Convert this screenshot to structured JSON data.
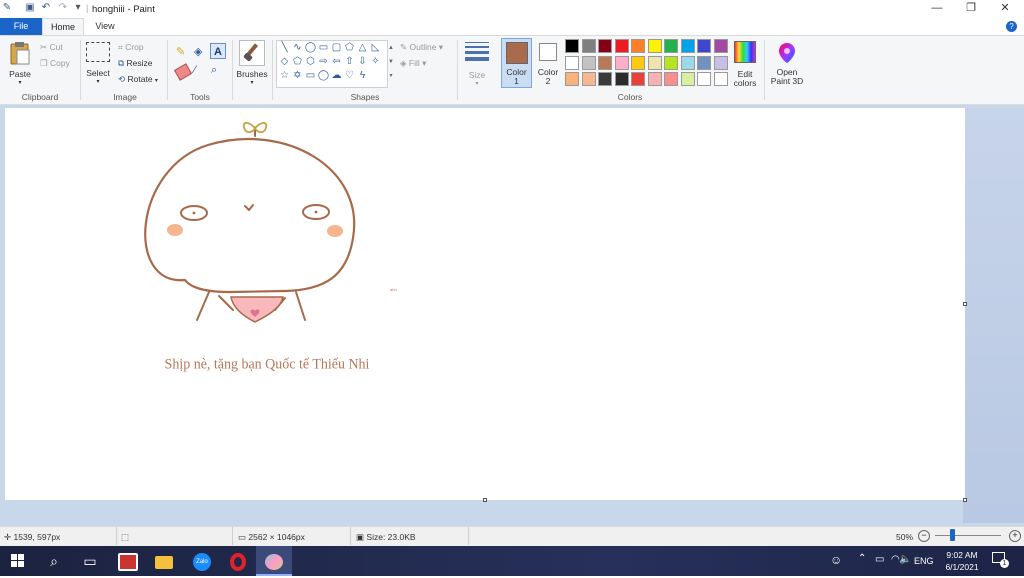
{
  "window": {
    "title": "honghiii - Paint",
    "qat_divider": "|",
    "qat_dropdown": "▾",
    "minimize": "—",
    "maximize": "❐",
    "close": "✕"
  },
  "tabs": {
    "file": "File",
    "home": "Home",
    "view": "View",
    "help": "?"
  },
  "ribbon": {
    "clipboard": {
      "group": "Clipboard",
      "paste": "Paste",
      "cut": "Cut",
      "copy": "Copy"
    },
    "image": {
      "group": "Image",
      "select": "Select",
      "crop": "Crop",
      "resize": "Resize",
      "rotate": "Rotate"
    },
    "tools": {
      "group": "Tools",
      "text_tool": "A"
    },
    "brushes": {
      "label": "Brushes"
    },
    "shapes": {
      "group": "Shapes",
      "outline": "Outline",
      "fill": "Fill"
    },
    "size": {
      "label": "Size"
    },
    "color1": {
      "label": "Color",
      "num": "1",
      "hex": "#a86b4e"
    },
    "color2": {
      "label": "Color",
      "num": "2",
      "hex": "#ffffff"
    },
    "colors": {
      "group": "Colors",
      "row1": [
        "#000000",
        "#7f7f7f",
        "#880015",
        "#ed1c24",
        "#ff7f27",
        "#fff200",
        "#22b14c",
        "#00a2e8",
        "#3f48cc",
        "#a349a4"
      ],
      "row2": [
        "#ffffff",
        "#c3c3c3",
        "#b97a57",
        "#ffaec9",
        "#ffc90e",
        "#efe4b0",
        "#b5e61d",
        "#99d9ea",
        "#7092be",
        "#c8bfe7"
      ],
      "row3": [
        "#f8b27c",
        "#f6b791",
        "#3a3a3a",
        "#2b2b2b",
        "#e8413c",
        "#f7b2b6",
        "#f78f8f",
        "#d9f0a3",
        "#ffffff",
        "#ffffff"
      ],
      "edit": "Edit colors",
      "edit_line1": "Edit",
      "edit_line2": "colors"
    },
    "paint3d": {
      "line1": "Open",
      "line2": "Paint 3D"
    }
  },
  "canvas_text": {
    "caption": "Shịp nè, tặng bạn Quốc tế Thiếu Nhi",
    "tiny": "ahh"
  },
  "status": {
    "cursor_pos": "1539, 597px",
    "image_size": "2562 × 1046px",
    "file_size": "Size: 23.0KB",
    "zoom": "50%",
    "zoom_minus": "−",
    "zoom_plus": "+",
    "zoom_fraction": 0.25
  },
  "taskbar": {
    "lang": "ENG",
    "time": "9:02 AM",
    "date": "6/1/2021",
    "notifications": "1",
    "tray_up": "⌃"
  },
  "colors": {
    "stroke": "#a8694a",
    "blush": "#f6b48f",
    "bib": "#f8b8bc",
    "sprout": "#c8a040",
    "caption": "#b5785a",
    "accent": "#1a65c7"
  }
}
